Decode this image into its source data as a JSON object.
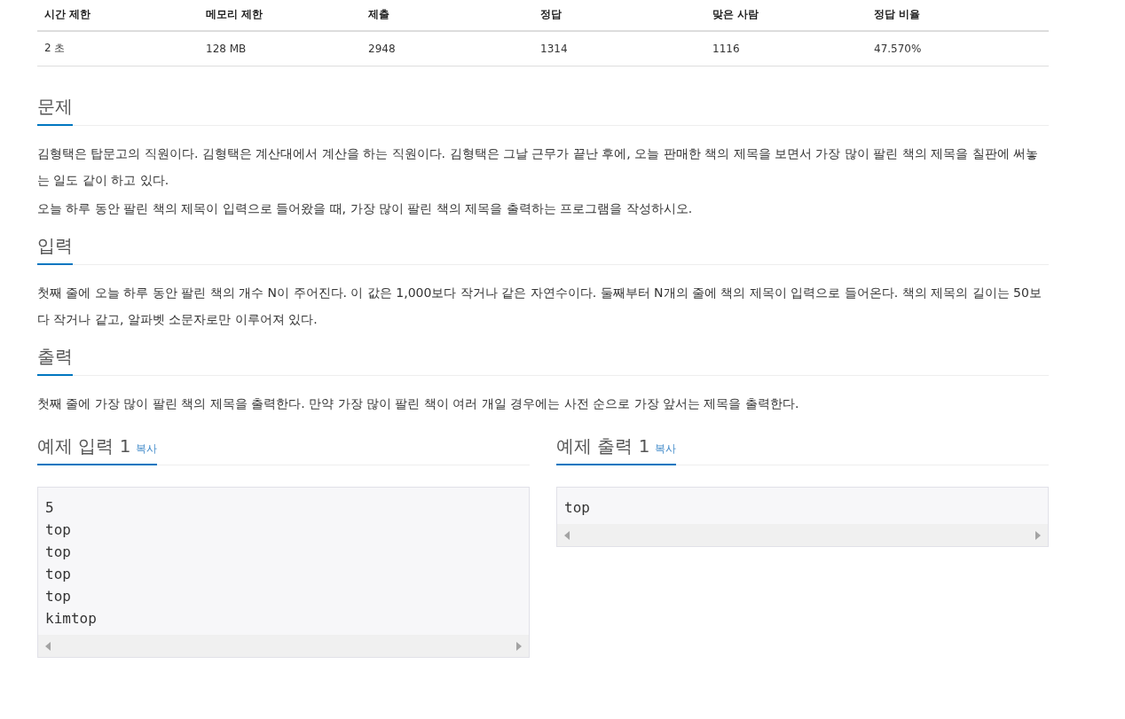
{
  "info_table": {
    "columns": [
      "시간 제한",
      "메모리 제한",
      "제출",
      "정답",
      "맞은 사람",
      "정답 비율"
    ],
    "rows": [
      [
        "2 초",
        "128 MB",
        "2948",
        "1314",
        "1116",
        "47.570%"
      ]
    ]
  },
  "sections": [
    {
      "title": "문제",
      "paragraphs": [
        "김형택은 탑문고의 직원이다. 김형택은 계산대에서 계산을 하는 직원이다. 김형택은 그날 근무가 끝난 후에, 오늘 판매한 책의 제목을 보면서 가장 많이 팔린 책의 제목을 칠판에 써놓는 일도 같이 하고 있다.",
        "오늘 하루 동안 팔린 책의 제목이 입력으로 들어왔을 때, 가장 많이 팔린 책의 제목을 출력하는 프로그램을 작성하시오."
      ]
    },
    {
      "title": "입력",
      "paragraphs": [
        "첫째 줄에 오늘 하루 동안 팔린 책의 개수 N이 주어진다. 이 값은 1,000보다 작거나 같은 자연수이다. 둘째부터 N개의 줄에 책의 제목이 입력으로 들어온다. 책의 제목의 길이는 50보다 작거나 같고, 알파벳 소문자로만 이루어져 있다."
      ]
    },
    {
      "title": "출력",
      "paragraphs": [
        "첫째 줄에 가장 많이 팔린 책의 제목을 출력한다. 만약 가장 많이 팔린 책이 여러 개일 경우에는 사전 순으로 가장 앞서는 제목을 출력한다."
      ]
    }
  ],
  "samples": [
    {
      "title": "예제 입력 1",
      "copy": "복사",
      "lines": [
        "5",
        "top",
        "top",
        "top",
        "top",
        "kimtop"
      ]
    },
    {
      "title": "예제 출력 1",
      "copy": "복사",
      "lines": [
        "top"
      ]
    }
  ]
}
